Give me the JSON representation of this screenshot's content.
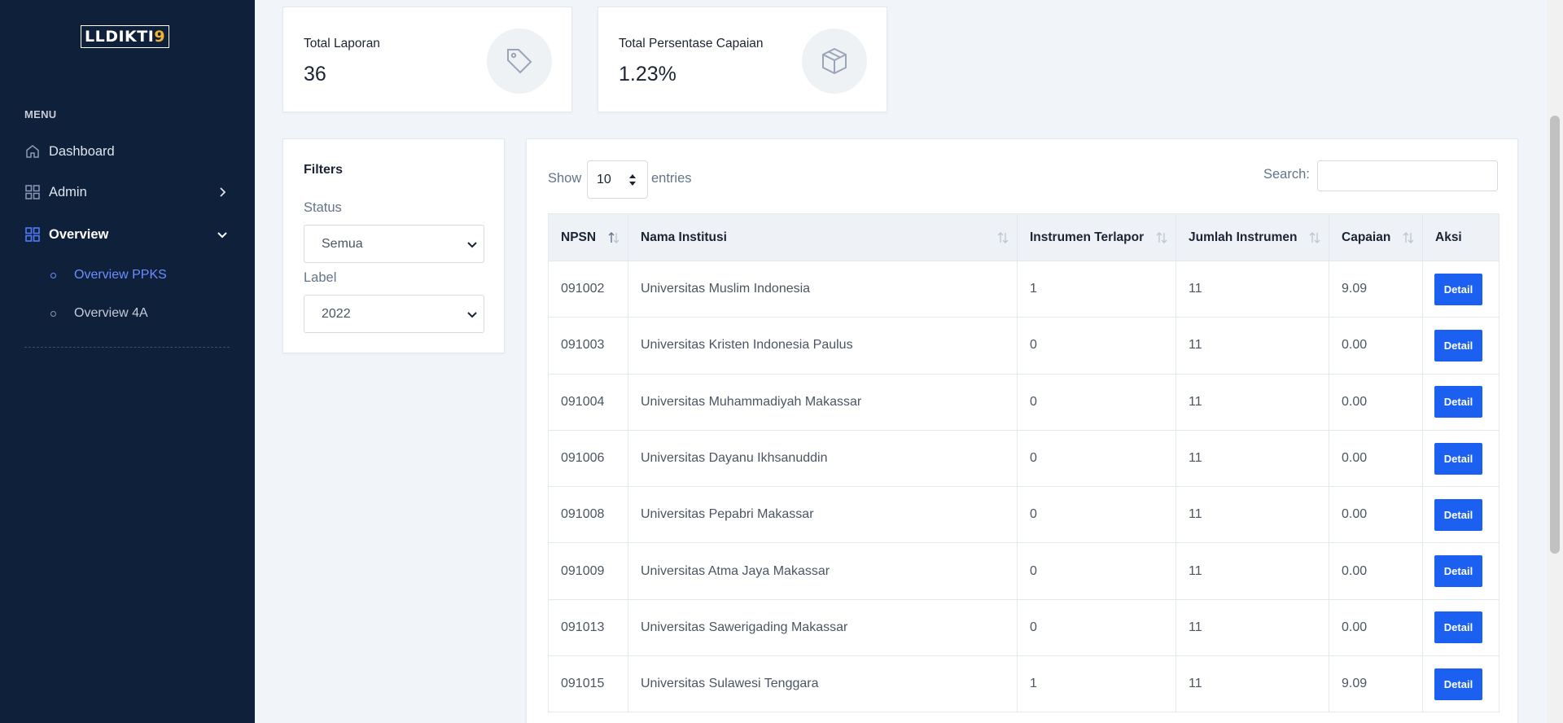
{
  "app": {
    "logo_text": "LLDIKTI",
    "logo_number": "9",
    "accent_color": "#1c60f2",
    "sidebar_color": "#0f203b"
  },
  "sidebar": {
    "menu_label": "MENU",
    "items": [
      {
        "label": "Dashboard",
        "icon": "home-icon"
      },
      {
        "label": "Admin",
        "icon": "grid-icon",
        "chevron": "chevron-right-icon"
      },
      {
        "label": "Overview",
        "icon": "grid-icon",
        "chevron": "chevron-down-icon",
        "active": true
      }
    ],
    "subitems": [
      {
        "label": "Overview PPKS",
        "active": true
      },
      {
        "label": "Overview 4A"
      }
    ]
  },
  "stats": [
    {
      "title": "Total Laporan",
      "value": "36",
      "icon": "tag-icon"
    },
    {
      "title": "Total Persentase Capaian",
      "value": "1.23%",
      "icon": "box-icon"
    }
  ],
  "filters": {
    "title": "Filters",
    "status_label": "Status",
    "status_value": "Semua",
    "label_label": "Label",
    "label_value": "2022"
  },
  "table_controls": {
    "show_label": "Show",
    "entries_value": "10",
    "entries_label": "entries",
    "search_label": "Search:",
    "search_value": ""
  },
  "table": {
    "columns": [
      "NPSN",
      "Nama Institusi",
      "Instrumen Terlapor",
      "Jumlah Instrumen",
      "Capaian",
      "Aksi"
    ],
    "action_label": "Detail",
    "rows": [
      {
        "npsn": "091002",
        "nama": "Universitas Muslim Indonesia",
        "terlapor": "1",
        "jumlah": "11",
        "capaian": "9.09"
      },
      {
        "npsn": "091003",
        "nama": "Universitas Kristen Indonesia Paulus",
        "terlapor": "0",
        "jumlah": "11",
        "capaian": "0.00"
      },
      {
        "npsn": "091004",
        "nama": "Universitas Muhammadiyah Makassar",
        "terlapor": "0",
        "jumlah": "11",
        "capaian": "0.00"
      },
      {
        "npsn": "091006",
        "nama": "Universitas Dayanu Ikhsanuddin",
        "terlapor": "0",
        "jumlah": "11",
        "capaian": "0.00"
      },
      {
        "npsn": "091008",
        "nama": "Universitas Pepabri Makassar",
        "terlapor": "0",
        "jumlah": "11",
        "capaian": "0.00"
      },
      {
        "npsn": "091009",
        "nama": "Universitas Atma Jaya Makassar",
        "terlapor": "0",
        "jumlah": "11",
        "capaian": "0.00"
      },
      {
        "npsn": "091013",
        "nama": "Universitas Sawerigading Makassar",
        "terlapor": "0",
        "jumlah": "11",
        "capaian": "0.00"
      },
      {
        "npsn": "091015",
        "nama": "Universitas Sulawesi Tenggara",
        "terlapor": "1",
        "jumlah": "11",
        "capaian": "9.09"
      }
    ]
  }
}
